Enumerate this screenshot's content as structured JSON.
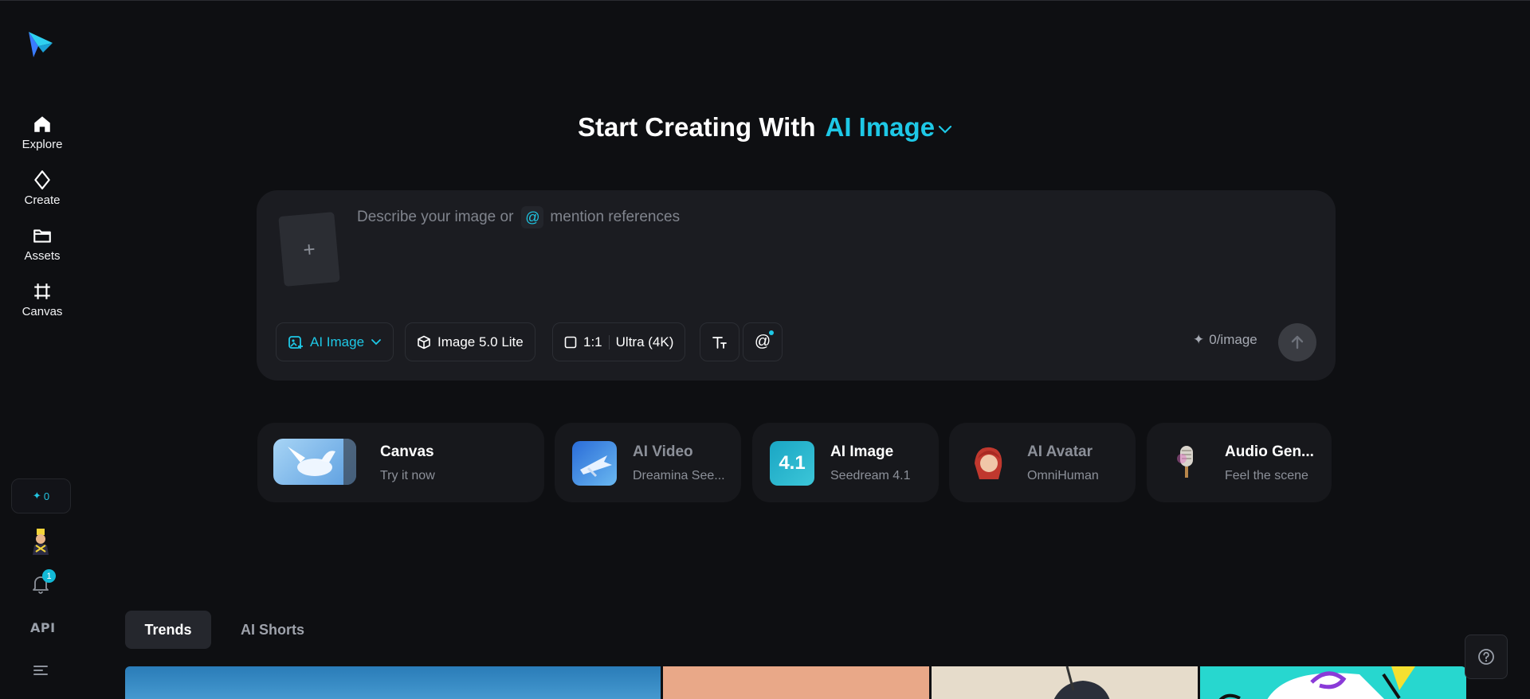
{
  "sidebar": {
    "logo_icon": "paper-plane-logo",
    "items": [
      {
        "label": "Explore",
        "icon": "home-icon"
      },
      {
        "label": "Create",
        "icon": "diamond-icon"
      },
      {
        "label": "Assets",
        "icon": "folder-icon"
      },
      {
        "label": "Canvas",
        "icon": "frame-icon"
      }
    ],
    "credits": "0",
    "notification_count": "1",
    "api_label": "API"
  },
  "heading": {
    "prefix": "Start Creating With",
    "mode": "AI Image"
  },
  "prompt": {
    "placeholder_before": "Describe your image or",
    "at_symbol": "@",
    "placeholder_after": "mention references",
    "upload_symbol": "+"
  },
  "toolbar": {
    "mode_label": "AI Image",
    "model_label": "Image 5.0 Lite",
    "ratio_label": "1:1",
    "quality_label": "Ultra (4K)",
    "mention_label": "@",
    "cost_label": "0/image"
  },
  "features": [
    {
      "title": "Canvas",
      "subtitle": "Try it now"
    },
    {
      "title": "AI Video",
      "subtitle": "Dreamina See..."
    },
    {
      "title": "AI Image",
      "subtitle": "Seedream 4.1",
      "badge": "4.1"
    },
    {
      "title": "AI Avatar",
      "subtitle": "OmniHuman"
    },
    {
      "title": "Audio Gen...",
      "subtitle": "Feel the scene"
    }
  ],
  "tabs": [
    {
      "label": "Trends",
      "active": true
    },
    {
      "label": "AI Shorts",
      "active": false
    }
  ],
  "colors": {
    "accent": "#1ec8e6",
    "background": "#0e0f12",
    "panel": "#1b1c21"
  }
}
